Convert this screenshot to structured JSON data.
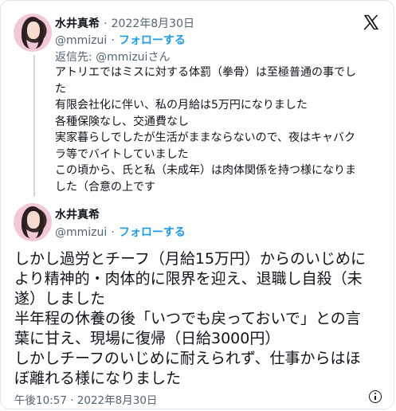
{
  "quoted_tweet": {
    "author_name": "水井真希",
    "separator": "·",
    "date": "2022年8月30日",
    "handle": "@mmizui",
    "follow_label": "フォローする",
    "reply_to": "返信先: @mmizuiさん",
    "lines": [
      "アトリエではミスに対する体罰（拳骨）は至極普通の事でし",
      "た",
      "有限会社化に伴い、私の月給は5万円になりました",
      "各種保険なし、交通費なし",
      "実家暮らしでしたが生活がままならないので、夜はキャバク",
      "ラ等でバイトしていました",
      "この頃から、氏と私（未成年）は肉体関係を持つ様になりま",
      "した（合意の上です"
    ]
  },
  "main_tweet": {
    "author_name": "水井真希",
    "handle": "@mmizui",
    "separator": "·",
    "follow_label": "フォローする",
    "lines": [
      "しかし過労とチーフ（月給15万円）からのいじめに",
      "より精神的・肉体的に限界を迎え、退職し自殺（未",
      "遂）しました",
      "半年程の休養の後「いつでも戻っておいで」との言",
      "葉に甘え、現場に復帰（日給3000円）",
      "しかしチーフのいじめに耐えられず、仕事からはほ",
      "ぼ離れる様になりました"
    ],
    "timestamp": "午後10:57 · 2022年8月30日"
  },
  "icons": {
    "x_logo": "x-logo-icon",
    "info": "info-icon"
  }
}
